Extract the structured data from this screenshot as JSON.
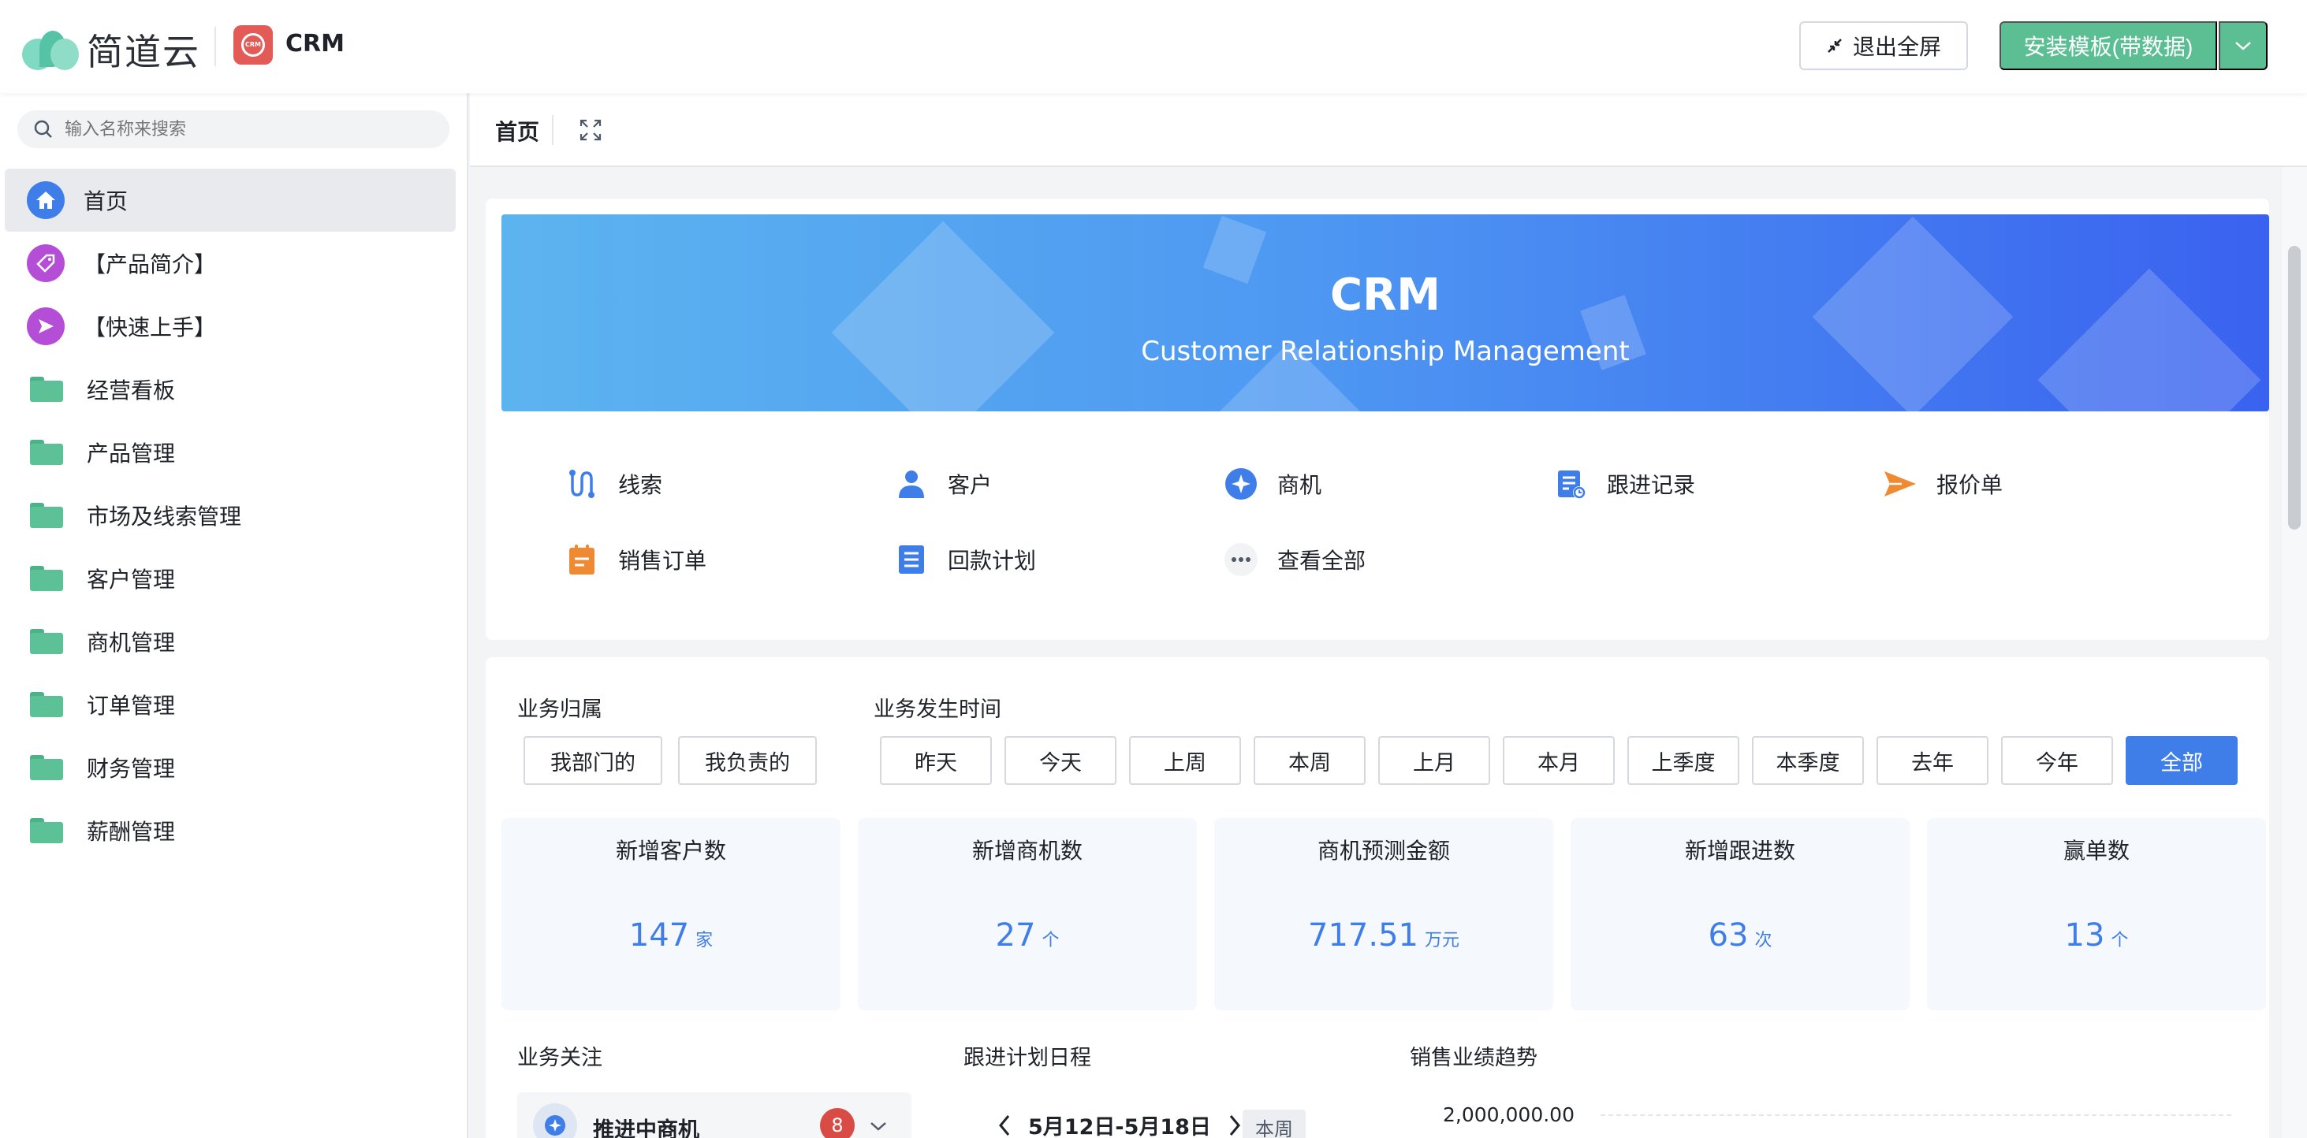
{
  "header": {
    "brand_name": "简道云",
    "app_name": "CRM",
    "app_badge_text": "CRM",
    "exit_fullscreen_label": "退出全屏",
    "install_label": "安装模板(带数据)"
  },
  "sidebar": {
    "search_placeholder": "输入名称来搜索",
    "items": [
      {
        "label": "首页",
        "icon": "home-icon",
        "color": "#3f7ee8"
      },
      {
        "label": "【产品简介】",
        "icon": "tag-icon",
        "color": "#b54ed6"
      },
      {
        "label": "【快速上手】",
        "icon": "send-icon",
        "color": "#b54ed6"
      },
      {
        "label": "经营看板",
        "icon": "folder-icon"
      },
      {
        "label": "产品管理",
        "icon": "folder-icon"
      },
      {
        "label": "市场及线索管理",
        "icon": "folder-icon"
      },
      {
        "label": "客户管理",
        "icon": "folder-icon"
      },
      {
        "label": "商机管理",
        "icon": "folder-icon"
      },
      {
        "label": "订单管理",
        "icon": "folder-icon"
      },
      {
        "label": "财务管理",
        "icon": "folder-icon"
      },
      {
        "label": "薪酬管理",
        "icon": "folder-icon"
      }
    ]
  },
  "page": {
    "tab_label": "首页"
  },
  "banner": {
    "title": "CRM",
    "subtitle": "Customer Relationship Management"
  },
  "quick_links": [
    {
      "label": "线索",
      "icon": "lead-icon"
    },
    {
      "label": "客户",
      "icon": "customer-icon"
    },
    {
      "label": "商机",
      "icon": "opportunity-icon"
    },
    {
      "label": "跟进记录",
      "icon": "followup-icon"
    },
    {
      "label": "报价单",
      "icon": "quote-icon"
    },
    {
      "label": "销售订单",
      "icon": "order-icon"
    },
    {
      "label": "回款计划",
      "icon": "payment-plan-icon"
    },
    {
      "label": "查看全部",
      "icon": "more-icon"
    }
  ],
  "filters": {
    "ownership_title": "业务归属",
    "ownership_options": [
      "我部门的",
      "我负责的"
    ],
    "time_title": "业务发生时间",
    "time_options": [
      "昨天",
      "今天",
      "上周",
      "本周",
      "上月",
      "本月",
      "上季度",
      "本季度",
      "去年",
      "今年",
      "全部"
    ],
    "time_selected": "全部"
  },
  "stats": [
    {
      "title": "新增客户数",
      "value": "147",
      "unit": "家"
    },
    {
      "title": "新增商机数",
      "value": "27",
      "unit": "个"
    },
    {
      "title": "商机预测金额",
      "value": "717.51",
      "unit": "万元"
    },
    {
      "title": "新增跟进数",
      "value": "63",
      "unit": "次"
    },
    {
      "title": "赢单数",
      "value": "13",
      "unit": "个"
    }
  ],
  "bottom": {
    "focus_title": "业务关注",
    "focus_item_label": "推进中商机",
    "focus_item_count": "8",
    "schedule_title": "跟进计划日程",
    "schedule_range": "5月12日-5月18日",
    "schedule_tag": "本周",
    "trend_title": "销售业绩趋势",
    "trend_axis_top": "2,000,000.00"
  },
  "colors": {
    "accent": "#3f7ee8",
    "brand_green": "#5cbf94"
  }
}
